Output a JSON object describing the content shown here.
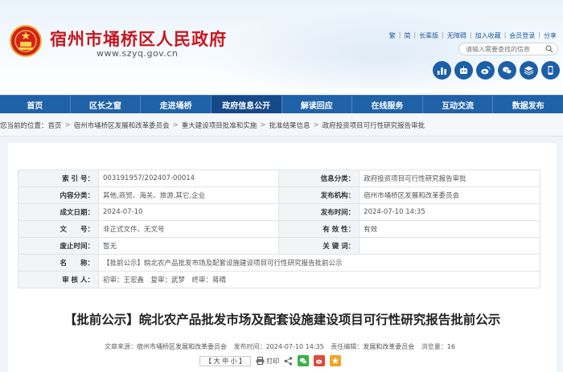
{
  "site": {
    "title": "宿州市埇桥区人民政府",
    "url": "www.szyq.gov.cn"
  },
  "toplinks": [
    "繁",
    "简",
    "长辈版",
    "无障碍",
    "加入收藏",
    "会员登录",
    "分享"
  ],
  "search": {
    "placeholder": "请输入需要查找的信息"
  },
  "header_icons": [
    "bar-chart-icon",
    "robot-icon",
    "weibo-icon",
    "wechat-icon",
    "layers-icon",
    "mobile-icon"
  ],
  "nav": {
    "items": [
      "首页",
      "区长之窗",
      "走进埇桥",
      "政府信息公开",
      "解读回应",
      "在线服务",
      "互动交流",
      "数据发布"
    ],
    "active_index": 3
  },
  "breadcrumb": {
    "prefix": "您当前的位置：",
    "items": [
      "首页",
      "宿州市埇桥区发展和改革委员会",
      "重大建设项目批准和实施",
      "批准结果信息",
      "政府投资项目可行性研究报告审批"
    ]
  },
  "meta": {
    "index_label": "索 引 号：",
    "index_value": "003191957/202407-00014",
    "info_cat_label": "信息分类：",
    "info_cat_value": "政府投资项目可行性研究报告审批",
    "content_cat_label": "内容分类：",
    "content_cat_value": "其他,商贸、海关、旅游,其它,企业",
    "org_label": "发布机构：",
    "org_value": "宿州市埇桥区发展和改革委员会",
    "date_label": "成文日期：",
    "date_value": "2024-07-10",
    "pubtime_label": "发布时间：",
    "pubtime_value": "2024-07-10 14:35",
    "doc_label": "文　　号：",
    "doc_value": "非正式文件、无文号",
    "valid_label": "有 效 性：",
    "valid_value": "有效",
    "exp_label": "废止时间：",
    "exp_value": "暂无",
    "kw_label": "关 键 词：",
    "kw_value": "",
    "name_label": "名　　称：",
    "name_value": "【批前公示】皖北农产品批发市场及配套设施建设项目可行性研究报告批前公示",
    "review_label": "审 核 人：",
    "review_value": "初审：王宏鑫　复审：武梦　终审：蒋晴"
  },
  "article": {
    "title": "【批前公示】皖北农产品批发市场及配套设施建设项目可行性研究报告批前公示",
    "source_label": "文章来源：",
    "source_value": "宿州市埇桥区发展和改革委员会",
    "time_label": "发布时间：",
    "time_value": "2024-07-10 14:35",
    "editor_label": "责任编辑：",
    "editor_value": "发展和改革委员会",
    "views_label": "浏览量：",
    "views_value": "16"
  },
  "tools": {
    "font_size": "【 大 中 小 】",
    "print": "打印",
    "share_icons": [
      "wechat-share-icon",
      "weibo-share-icon",
      "favorite-icon"
    ]
  },
  "colors": {
    "brand_red": "#c8161d",
    "nav_blue": "#1f62a8",
    "nav_active": "#14498a"
  }
}
